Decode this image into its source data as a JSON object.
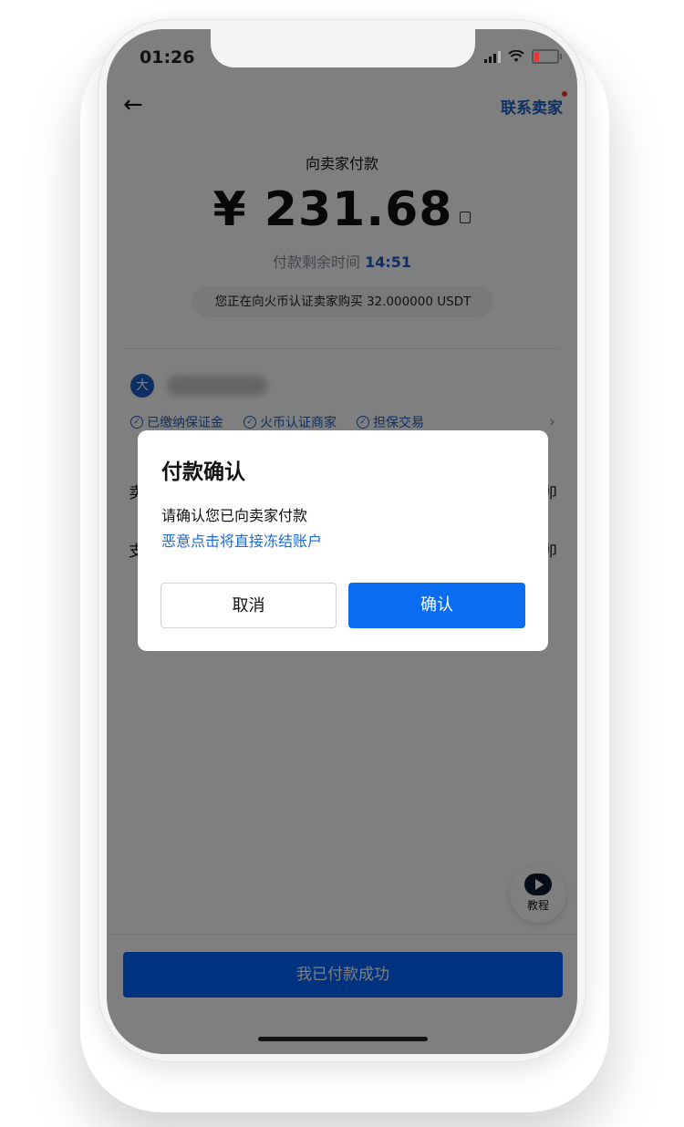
{
  "status_bar": {
    "time": "01:26"
  },
  "header": {
    "back_icon": "←",
    "contact_label": "联系卖家"
  },
  "payment": {
    "title": "向卖家付款",
    "amount": "¥ 231.68",
    "countdown_label": "付款剩余时间",
    "countdown_value": "14:51",
    "buy_info": "您正在向火币认证卖家购买 32.000000 USDT"
  },
  "seller": {
    "avatar_text": "大",
    "badges": [
      "已缴纳保证金",
      "火币认证商家",
      "担保交易"
    ]
  },
  "rows": [
    {
      "left": "卖",
      "right": "卯"
    },
    {
      "left": "支",
      "right": "卯"
    }
  ],
  "tutorial": {
    "label": "教程"
  },
  "paid_button": {
    "label": "我已付款成功"
  },
  "dialog": {
    "title": "付款确认",
    "line1": "请确认您已向卖家付款",
    "warning": "恶意点击将直接冻结账户",
    "cancel_label": "取消",
    "confirm_label": "确认"
  },
  "colors": {
    "accent": "#0a6cf0",
    "link": "#1b5ec4",
    "overlay": "rgba(0,0,0,0.5)"
  }
}
